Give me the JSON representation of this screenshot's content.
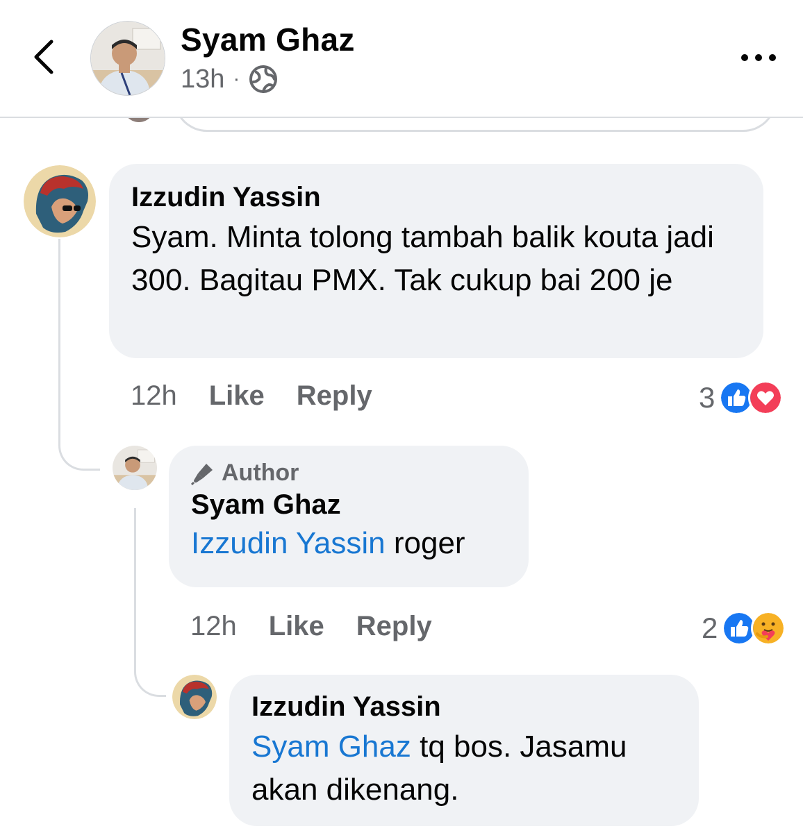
{
  "header": {
    "author_name": "Syam Ghaz",
    "time": "13h",
    "separator": "·"
  },
  "comments": [
    {
      "name": "Izzudin Yassin",
      "text": "Syam. Minta tolong tambah balik kouta jadi 300. Bagitau PMX. Tak cukup bai 200 je",
      "time": "12h",
      "like_label": "Like",
      "reply_label": "Reply",
      "reaction_count": "3",
      "reactions": [
        "like-icon",
        "love-icon"
      ]
    },
    {
      "badge": "Author",
      "name": "Syam Ghaz",
      "mention": "Izzudin Yassin",
      "text": " roger",
      "time": "12h",
      "like_label": "Like",
      "reply_label": "Reply",
      "reaction_count": "2",
      "reactions": [
        "like-icon",
        "care-icon"
      ]
    },
    {
      "name": "Izzudin Yassin",
      "mention": "Syam Ghaz",
      "text_line1": " tq bos. Jasamu",
      "text_line2": "akan dikenang."
    }
  ],
  "colors": {
    "mention": "#1877d2",
    "like_blue": "#1877f2",
    "love_red": "#f33e58",
    "care_yellow": "#f7b125",
    "bubble_bg": "#f0f2f5",
    "meta_grey": "#65676b"
  }
}
